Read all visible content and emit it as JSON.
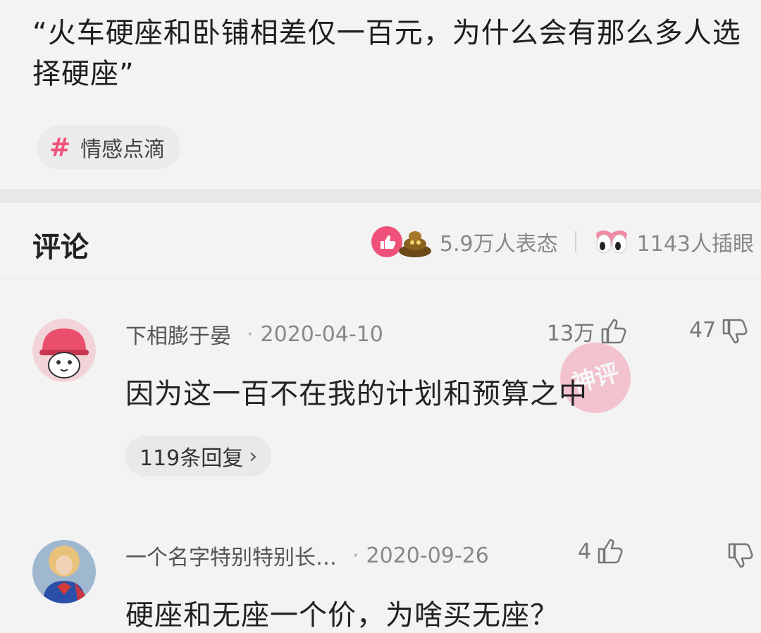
{
  "post": {
    "title": "“火车硬座和卧铺相差仅一百元，为什么会有那么多人选择硬座”",
    "topic": "情感点滴",
    "topic_icon": "hash-icon"
  },
  "comments_section": {
    "title": "评论",
    "reaction_count": "5.9万人表态",
    "eyeroll_count": "1143人插眼"
  },
  "comments": [
    {
      "user": "下相膨于晏",
      "date": "2020-04-10",
      "likes": "13万",
      "dislikes": "47",
      "text": "因为这一百不在我的计划和预算之中",
      "replies": "119条回复",
      "stamp": "神评"
    },
    {
      "user": "一个名字特别特别长…",
      "date": "2020-09-26",
      "likes": "4",
      "text": "硬座和无座一个价，为啥买无座？"
    }
  ],
  "colors": {
    "accent": "#f0517a",
    "background": "#f3f3f3"
  }
}
